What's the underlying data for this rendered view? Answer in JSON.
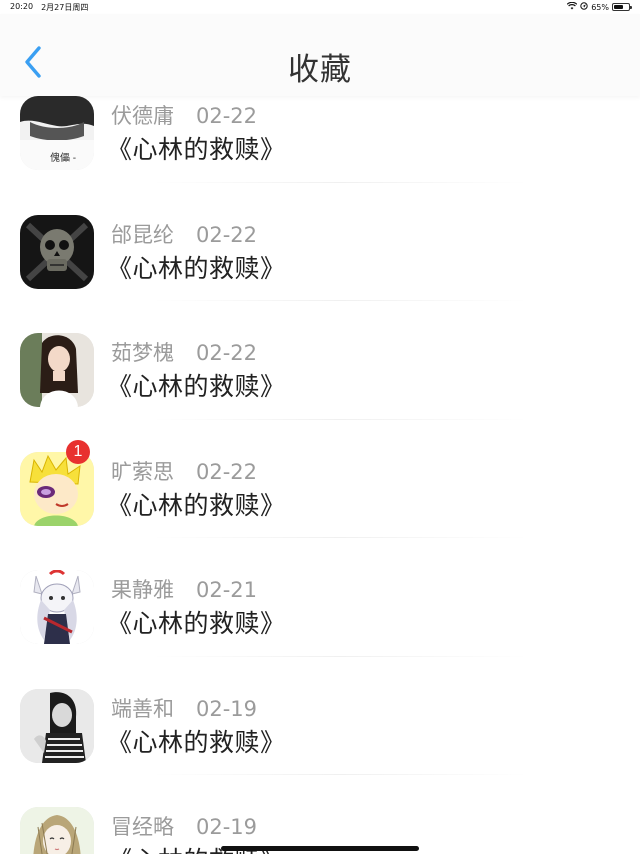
{
  "status_bar": {
    "time": "20:20",
    "date": "2月27日周四",
    "battery_percent": "65%",
    "battery_level": 0.65
  },
  "nav": {
    "title": "收藏",
    "back_icon": "chevron-left-icon",
    "accent_color": "#3a9ff2"
  },
  "items": [
    {
      "name": "伏德庸",
      "date": "02-22",
      "title": "《心林的救赎》",
      "avatar": "avatar-portrait-bw",
      "avatar_caption": "傀儡 -"
    },
    {
      "name": "邰昆纶",
      "date": "02-22",
      "title": "《心林的救赎》",
      "avatar": "avatar-skull"
    },
    {
      "name": "茹梦槐",
      "date": "02-22",
      "title": "《心林的救赎》",
      "avatar": "avatar-girl-photo"
    },
    {
      "name": "旷萦思",
      "date": "02-22",
      "title": "《心林的救赎》",
      "avatar": "avatar-cartoon-boy",
      "badge": "1"
    },
    {
      "name": "果静雅",
      "date": "02-21",
      "title": "《心林的救赎》",
      "avatar": "avatar-anime-girl"
    },
    {
      "name": "端善和",
      "date": "02-19",
      "title": "《心林的救赎》",
      "avatar": "avatar-bw-girl"
    },
    {
      "name": "冒经略",
      "date": "02-19",
      "title": "《心林的救赎》",
      "avatar": "avatar-sketch-girl"
    }
  ]
}
